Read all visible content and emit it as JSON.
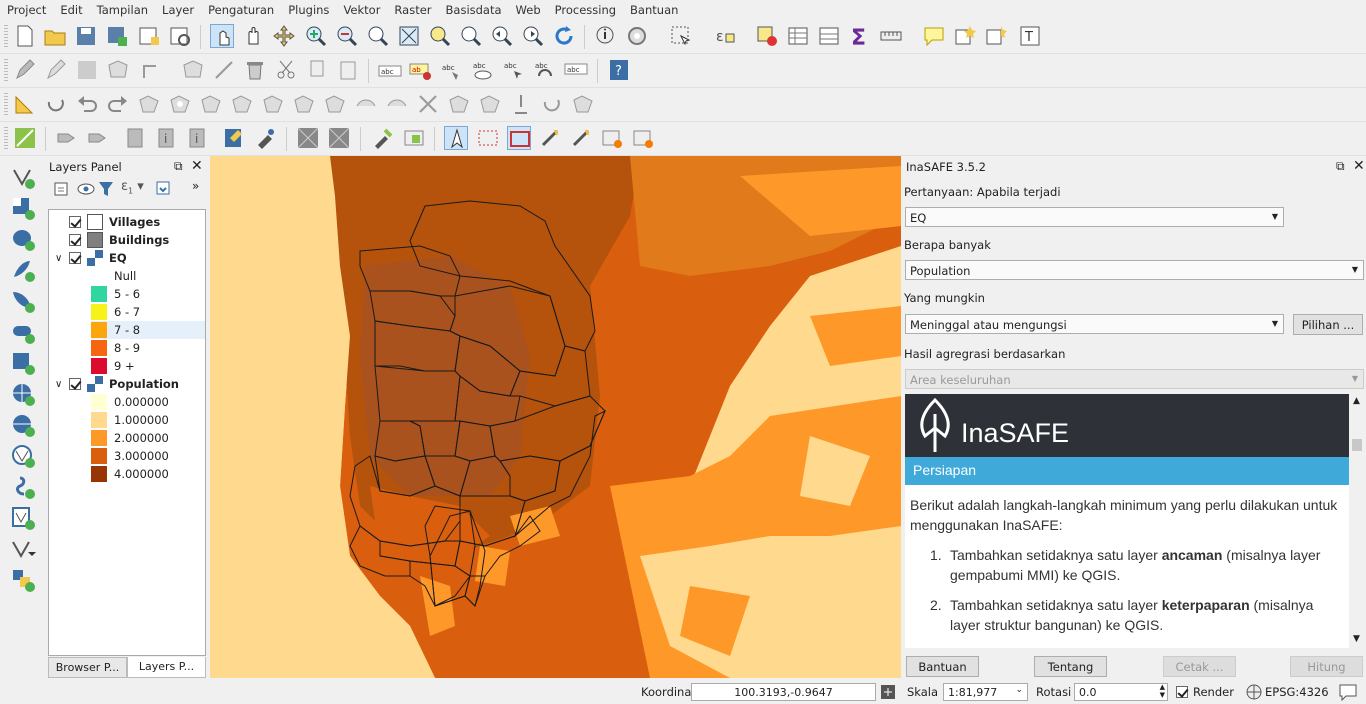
{
  "menu": [
    "Project",
    "Edit",
    "Tampilan",
    "Layer",
    "Pengaturan",
    "Plugins",
    "Vektor",
    "Raster",
    "Basisdata",
    "Web",
    "Processing",
    "Bantuan"
  ],
  "layers_panel": {
    "title": "Layers Panel",
    "layers": [
      {
        "name": "Villages",
        "checked": true,
        "swatch": "#ffffff"
      },
      {
        "name": "Buildings",
        "checked": true,
        "swatch": "#808080"
      },
      {
        "name": "EQ",
        "checked": true,
        "expanded": true,
        "legend": [
          {
            "label": "Null",
            "color": ""
          },
          {
            "label": "5 - 6",
            "color": "#2fd6a0"
          },
          {
            "label": "6 - 7",
            "color": "#f7f21a"
          },
          {
            "label": "7 - 8",
            "color": "#fba60c"
          },
          {
            "label": "8 - 9",
            "color": "#f5660f"
          },
          {
            "label": "9 +",
            "color": "#dc0a2c"
          }
        ]
      },
      {
        "name": "Population",
        "checked": true,
        "expanded": true,
        "legend": [
          {
            "label": "0.000000",
            "color": "#ffffd4"
          },
          {
            "label": "1.000000",
            "color": "#fed98e"
          },
          {
            "label": "2.000000",
            "color": "#fe9929"
          },
          {
            "label": "3.000000",
            "color": "#d95f0e"
          },
          {
            "label": "4.000000",
            "color": "#993404"
          }
        ]
      }
    ],
    "tabs": [
      "Browser P...",
      "Layers P..."
    ]
  },
  "inasafe": {
    "title": "InaSAFE 3.5.2",
    "q_label": "Pertanyaan: Apabila terjadi",
    "hazard": "EQ",
    "howmany_label": "Berapa banyak",
    "exposure": "Population",
    "might_label": "Yang mungkin",
    "impact": "Meninggal atau mengungsi",
    "options_button": "Pilihan ...",
    "agg_label": "Hasil agregrasi berdasarkan",
    "agg_value": "Area keseluruhan",
    "brand": "InaSAFE",
    "section": "Persiapan",
    "intro": "Berikut adalah langkah-langkah minimum yang perlu dilakukan untuk menggunakan InaSAFE:",
    "steps": [
      {
        "num": "1.",
        "pre": "Tambahkan setidaknya satu layer ",
        "bold": "ancaman",
        "post": " (misalnya layer gempabumi MMI) ke QGIS."
      },
      {
        "num": "2.",
        "pre": "Tambahkan setidaknya satu layer ",
        "bold": "keterpaparan",
        "post": " (misalnya layer struktur bangunan) ke QGIS."
      }
    ],
    "buttons": {
      "help": "Bantuan",
      "about": "Tentang",
      "print": "Cetak ...",
      "run": "Hitung"
    }
  },
  "status": {
    "coord_label": "Koordinat",
    "coord": "100.3193,-0.9647",
    "scale_label": "Skala",
    "scale": "1:81,977",
    "rot_label": "Rotasi",
    "rot": "0.0",
    "render_label": "Render",
    "crs": "EPSG:4326"
  }
}
